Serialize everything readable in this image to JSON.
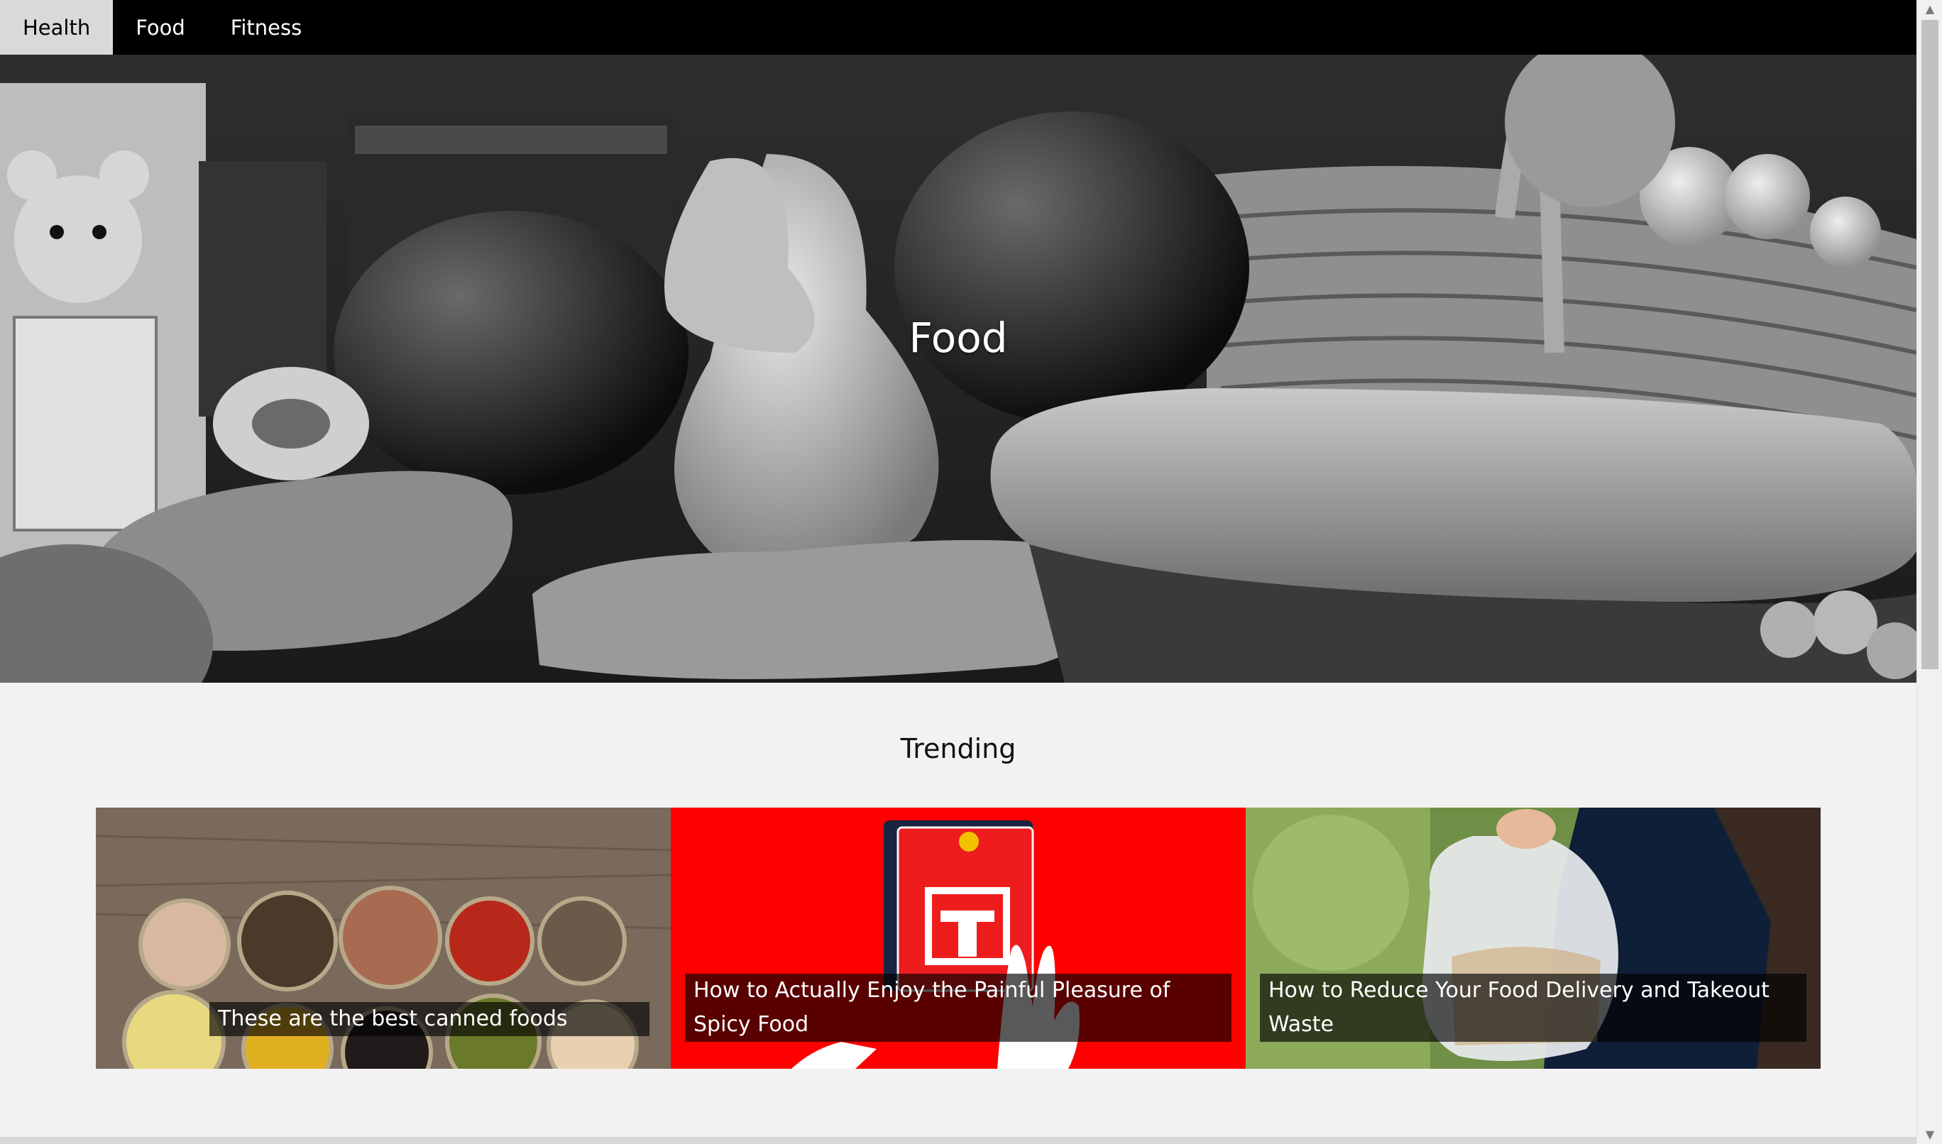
{
  "nav": {
    "items": [
      {
        "label": "Health",
        "active": true
      },
      {
        "label": "Food",
        "active": false
      },
      {
        "label": "Fitness",
        "active": false
      }
    ]
  },
  "hero": {
    "title": "Food"
  },
  "trending": {
    "title": "Trending",
    "cards": [
      {
        "caption": "These are the best canned foods"
      },
      {
        "caption": "How to Actually Enjoy the Painful Pleasure of Spicy Food"
      },
      {
        "caption": "How to Reduce Your Food Delivery and Takeout Waste"
      }
    ]
  },
  "colors": {
    "nav_bg": "#000000",
    "nav_active_bg": "#d9d9d9",
    "page_bg": "#f2f2f2",
    "spicy_card_bg": "#ff0000"
  }
}
